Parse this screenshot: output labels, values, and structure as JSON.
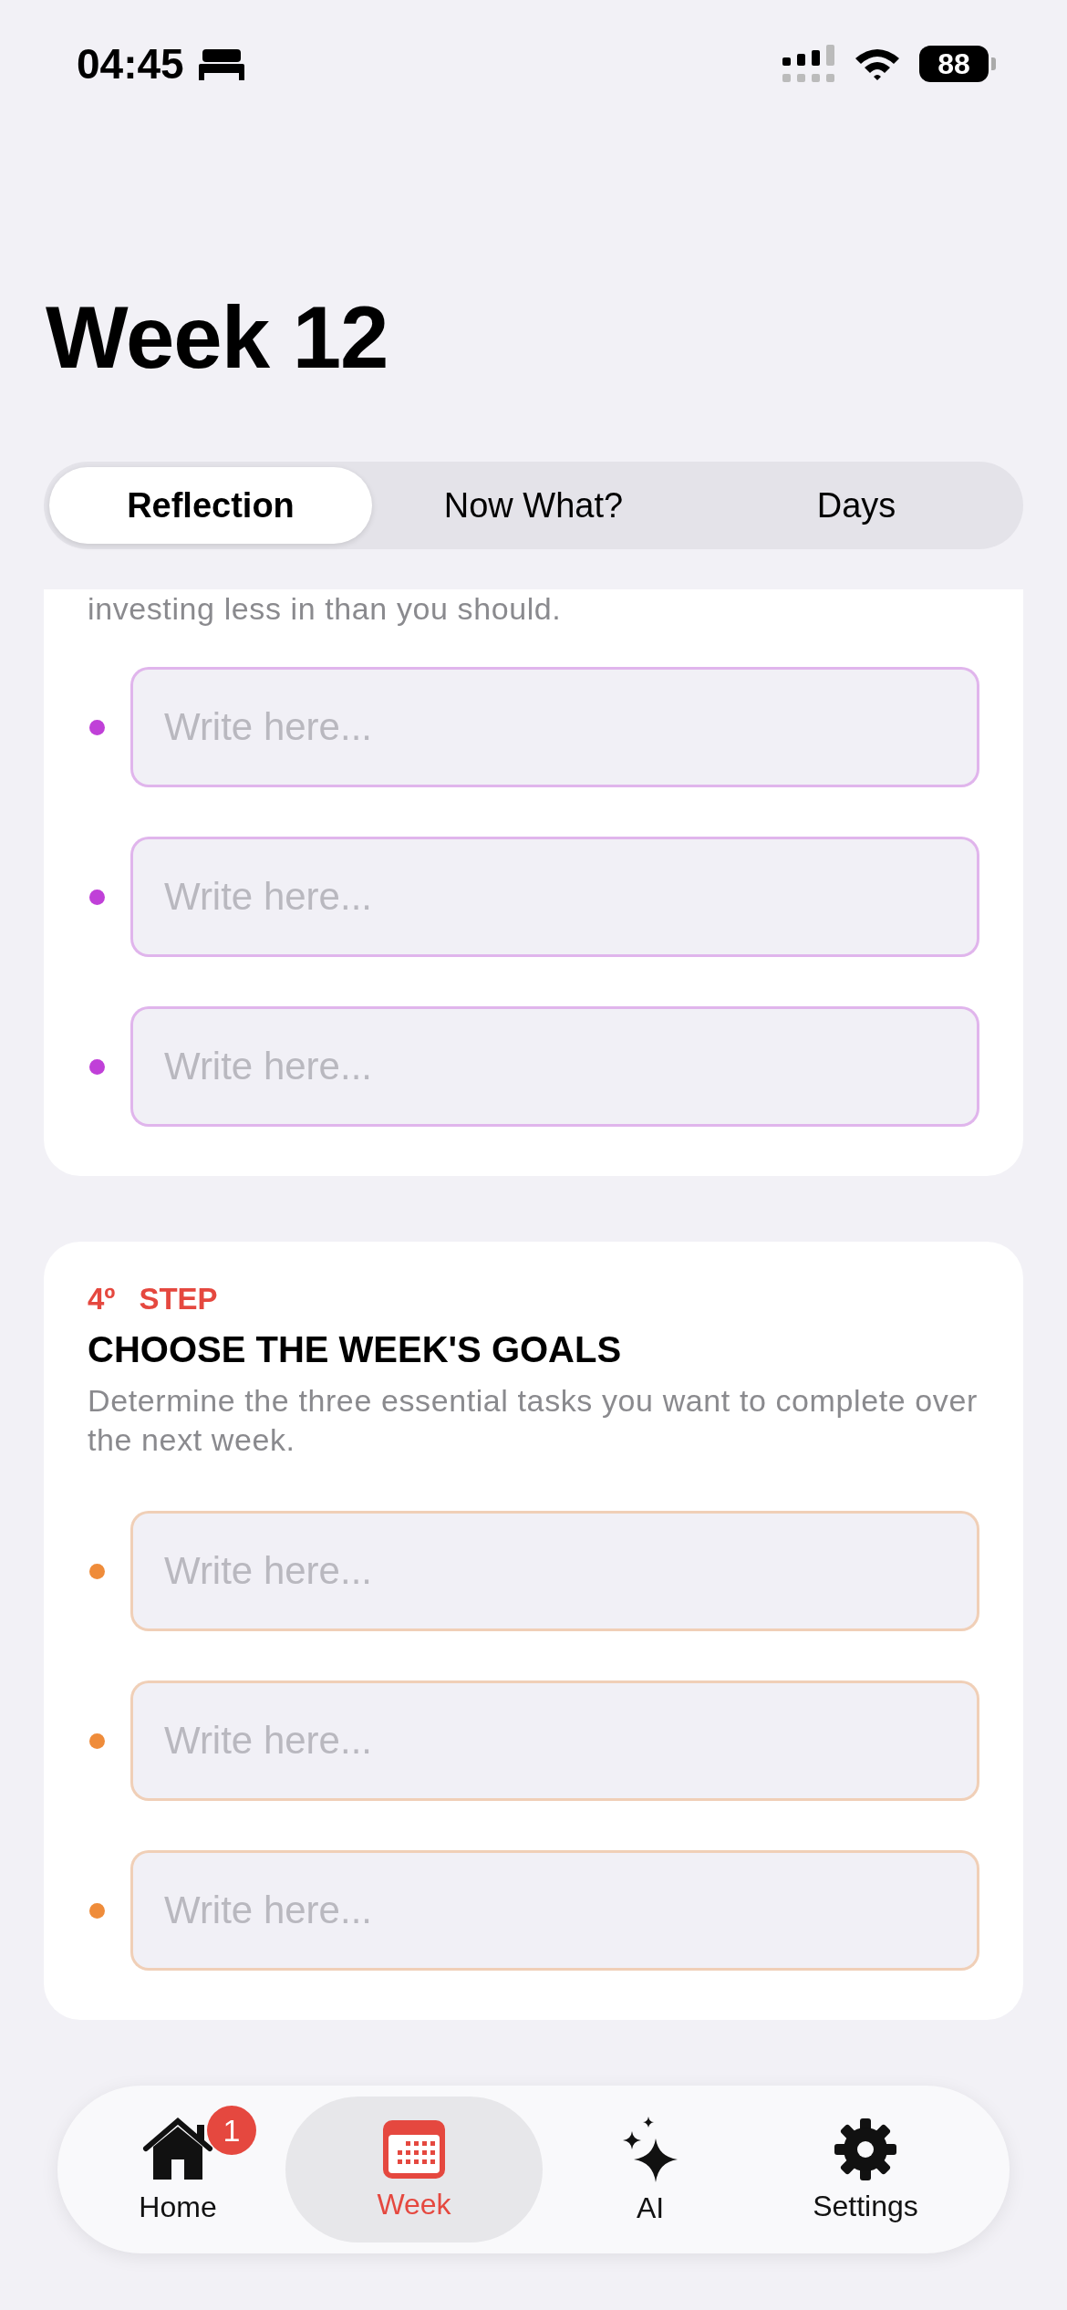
{
  "status_bar": {
    "time": "04:45",
    "battery": "88"
  },
  "title": "Week 12",
  "tabs": [
    {
      "label": "Reflection",
      "selected": true
    },
    {
      "label": "Now What?",
      "selected": false
    },
    {
      "label": "Days",
      "selected": false
    }
  ],
  "sections": [
    {
      "description": "investing less in than you should.",
      "color": "#c040d8",
      "fields": [
        {
          "placeholder": "Write here..."
        },
        {
          "placeholder": "Write here..."
        },
        {
          "placeholder": "Write here..."
        }
      ]
    },
    {
      "step_number": "4º",
      "step_label": "STEP",
      "title": "CHOOSE THE WEEK'S GOALS",
      "description": "Determine the three essential tasks you want to complete over the next week.",
      "color": "#ef8c3a",
      "fields": [
        {
          "placeholder": "Write here..."
        },
        {
          "placeholder": "Write here..."
        },
        {
          "placeholder": "Write here..."
        }
      ]
    }
  ],
  "nav": [
    {
      "label": "Home",
      "selected": false,
      "badge": "1"
    },
    {
      "label": "Week",
      "selected": true
    },
    {
      "label": "AI",
      "selected": false
    },
    {
      "label": "Settings",
      "selected": false
    }
  ]
}
